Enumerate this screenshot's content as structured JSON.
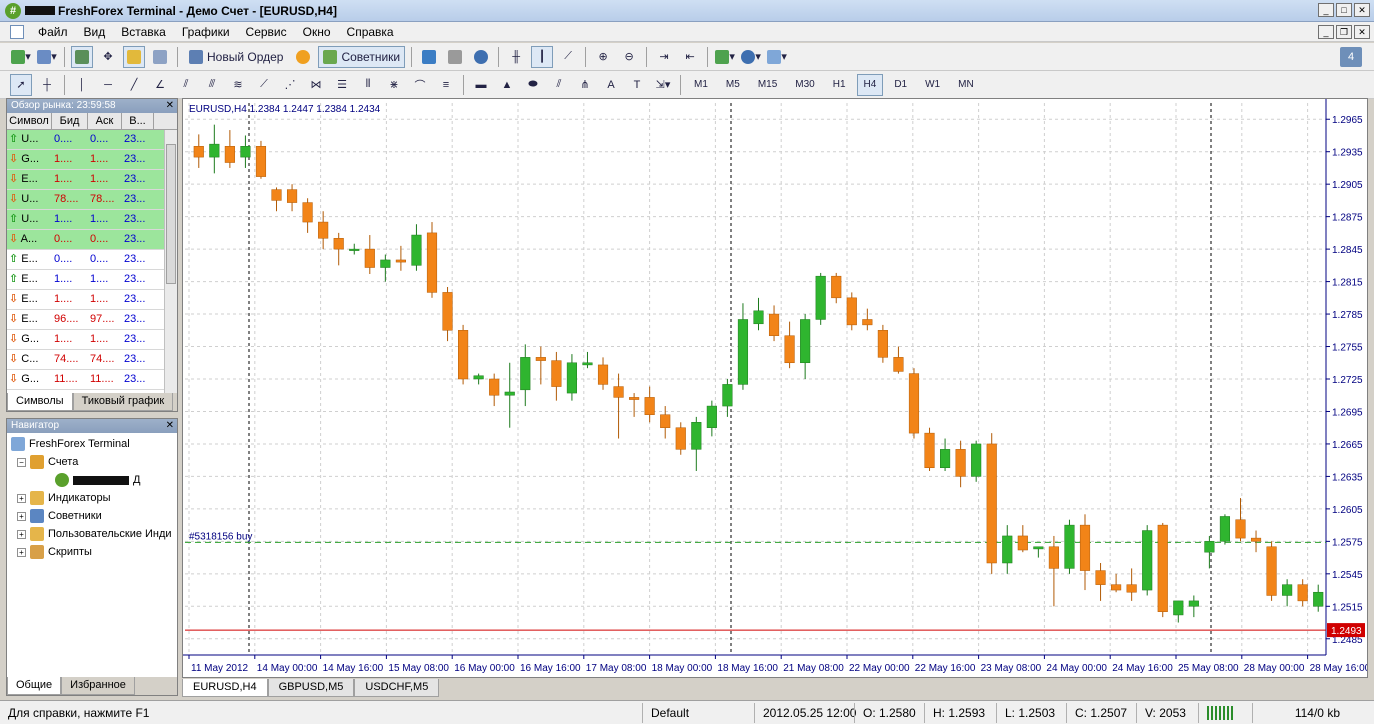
{
  "title": {
    "app": "FreshForex Terminal",
    "account_type": "Демо Счет",
    "chart": "[EURUSD,H4]",
    "separator": " - "
  },
  "menu": [
    "Файл",
    "Вид",
    "Вставка",
    "Графики",
    "Сервис",
    "Окно",
    "Справка"
  ],
  "toolbar": {
    "new_order": "Новый Ордер",
    "advisors": "Советники",
    "timeframes": [
      "M1",
      "M5",
      "M15",
      "M30",
      "H1",
      "H4",
      "D1",
      "W1",
      "MN"
    ],
    "active_timeframe": "H4"
  },
  "market_watch": {
    "title": "Обзор рынка: 23:59:58",
    "headers": [
      "Символ",
      "Бид",
      "Аск",
      "В..."
    ],
    "rows": [
      {
        "dir": "up",
        "sym": "U...",
        "bid": "0....",
        "ask": "0....",
        "t": "23...",
        "hl": true,
        "color": "blue"
      },
      {
        "dir": "down",
        "sym": "G...",
        "bid": "1....",
        "ask": "1....",
        "t": "23...",
        "hl": true,
        "color": "red"
      },
      {
        "dir": "down",
        "sym": "E...",
        "bid": "1....",
        "ask": "1....",
        "t": "23...",
        "hl": true,
        "color": "red"
      },
      {
        "dir": "down",
        "sym": "U...",
        "bid": "78....",
        "ask": "78....",
        "t": "23...",
        "hl": true,
        "color": "red"
      },
      {
        "dir": "up",
        "sym": "U...",
        "bid": "1....",
        "ask": "1....",
        "t": "23...",
        "hl": true,
        "color": "blue"
      },
      {
        "dir": "down",
        "sym": "A...",
        "bid": "0....",
        "ask": "0....",
        "t": "23...",
        "hl": true,
        "color": "red"
      },
      {
        "dir": "up",
        "sym": "E...",
        "bid": "0....",
        "ask": "0....",
        "t": "23...",
        "hl": false,
        "color": "blue"
      },
      {
        "dir": "up",
        "sym": "E...",
        "bid": "1....",
        "ask": "1....",
        "t": "23...",
        "hl": false,
        "color": "blue"
      },
      {
        "dir": "down",
        "sym": "E...",
        "bid": "1....",
        "ask": "1....",
        "t": "23...",
        "hl": false,
        "color": "red"
      },
      {
        "dir": "down",
        "sym": "E...",
        "bid": "96....",
        "ask": "97....",
        "t": "23...",
        "hl": false,
        "color": "red"
      },
      {
        "dir": "down",
        "sym": "G...",
        "bid": "1....",
        "ask": "1....",
        "t": "23...",
        "hl": false,
        "color": "red"
      },
      {
        "dir": "down",
        "sym": "C...",
        "bid": "74....",
        "ask": "74....",
        "t": "23...",
        "hl": false,
        "color": "red"
      },
      {
        "dir": "down",
        "sym": "G...",
        "bid": "11....",
        "ask": "11....",
        "t": "23...",
        "hl": false,
        "color": "red"
      }
    ],
    "tabs": [
      "Символы",
      "Тиковый график"
    ]
  },
  "navigator": {
    "title": "Навигатор",
    "root": "FreshForex Terminal",
    "accounts": "Счета",
    "account_suffix": "Д",
    "indicators": "Индикаторы",
    "experts": "Советники",
    "custom": "Пользовательские Инди",
    "scripts": "Скрипты",
    "tabs": [
      "Общие",
      "Избранное"
    ]
  },
  "chart": {
    "header": "EURUSD,H4  1.2384 1.2447 1.2384 1.2434",
    "order_label": "#5318156 buy",
    "current_price": "1.2493",
    "tabs": [
      "EURUSD,H4",
      "GBPUSD,M5",
      "USDCHF,M5"
    ]
  },
  "chart_data": {
    "type": "candlestick",
    "symbol": "EURUSD",
    "timeframe": "H4",
    "y_ticks": [
      "1.2965",
      "1.2935",
      "1.2905",
      "1.2875",
      "1.2845",
      "1.2815",
      "1.2785",
      "1.2755",
      "1.2725",
      "1.2695",
      "1.2665",
      "1.2635",
      "1.2605",
      "1.2575",
      "1.2545",
      "1.2515",
      "1.2485"
    ],
    "ylim": [
      1.247,
      1.298
    ],
    "x_ticks": [
      "11 May 2012",
      "14 May 00:00",
      "14 May 16:00",
      "15 May 08:00",
      "16 May 00:00",
      "16 May 16:00",
      "17 May 08:00",
      "18 May 00:00",
      "18 May 16:00",
      "21 May 08:00",
      "22 May 00:00",
      "22 May 16:00",
      "23 May 08:00",
      "24 May 00:00",
      "24 May 16:00",
      "25 May 08:00",
      "28 May 00:00",
      "28 May 16:00"
    ],
    "order_level": 1.2574,
    "current_price": 1.2493,
    "candles": [
      [
        1.294,
        1.2951,
        1.292,
        1.293
      ],
      [
        1.293,
        1.296,
        1.2915,
        1.2942
      ],
      [
        1.294,
        1.2955,
        1.292,
        1.2925
      ],
      [
        1.293,
        1.295,
        1.292,
        1.294
      ],
      [
        1.294,
        1.2945,
        1.291,
        1.2912
      ],
      [
        1.29,
        1.2902,
        1.288,
        1.289
      ],
      [
        1.29,
        1.2905,
        1.288,
        1.2888
      ],
      [
        1.2888,
        1.2892,
        1.286,
        1.287
      ],
      [
        1.287,
        1.288,
        1.2845,
        1.2855
      ],
      [
        1.2855,
        1.286,
        1.283,
        1.2845
      ],
      [
        1.2844,
        1.285,
        1.284,
        1.2845
      ],
      [
        1.2845,
        1.2858,
        1.2822,
        1.2828
      ],
      [
        1.2828,
        1.284,
        1.2815,
        1.2835
      ],
      [
        1.2835,
        1.2848,
        1.2825,
        1.2833
      ],
      [
        1.283,
        1.2868,
        1.2825,
        1.2858
      ],
      [
        1.286,
        1.287,
        1.28,
        1.2805
      ],
      [
        1.2805,
        1.281,
        1.276,
        1.277
      ],
      [
        1.277,
        1.2775,
        1.272,
        1.2725
      ],
      [
        1.2725,
        1.273,
        1.272,
        1.2728
      ],
      [
        1.2725,
        1.273,
        1.27,
        1.271
      ],
      [
        1.271,
        1.274,
        1.268,
        1.2713
      ],
      [
        1.2715,
        1.2757,
        1.27,
        1.2745
      ],
      [
        1.2745,
        1.2755,
        1.272,
        1.2742
      ],
      [
        1.2742,
        1.275,
        1.2705,
        1.2718
      ],
      [
        1.2712,
        1.2748,
        1.2705,
        1.274
      ],
      [
        1.2738,
        1.275,
        1.2735,
        1.274
      ],
      [
        1.2738,
        1.2745,
        1.2715,
        1.272
      ],
      [
        1.2718,
        1.273,
        1.267,
        1.2708
      ],
      [
        1.2708,
        1.2712,
        1.269,
        1.2706
      ],
      [
        1.2708,
        1.2718,
        1.2685,
        1.2692
      ],
      [
        1.2692,
        1.27,
        1.267,
        1.268
      ],
      [
        1.268,
        1.2685,
        1.2655,
        1.266
      ],
      [
        1.266,
        1.269,
        1.264,
        1.2685
      ],
      [
        1.268,
        1.2705,
        1.2672,
        1.27
      ],
      [
        1.27,
        1.2725,
        1.269,
        1.272
      ],
      [
        1.272,
        1.2795,
        1.2715,
        1.278
      ],
      [
        1.2776,
        1.28,
        1.277,
        1.2788
      ],
      [
        1.2785,
        1.2793,
        1.276,
        1.2765
      ],
      [
        1.2765,
        1.2778,
        1.2735,
        1.274
      ],
      [
        1.274,
        1.2785,
        1.2725,
        1.278
      ],
      [
        1.278,
        1.2823,
        1.2775,
        1.282
      ],
      [
        1.282,
        1.2823,
        1.2795,
        1.28
      ],
      [
        1.28,
        1.2805,
        1.277,
        1.2775
      ],
      [
        1.278,
        1.279,
        1.277,
        1.2775
      ],
      [
        1.277,
        1.2775,
        1.274,
        1.2745
      ],
      [
        1.2745,
        1.2755,
        1.273,
        1.2732
      ],
      [
        1.273,
        1.2735,
        1.267,
        1.2675
      ],
      [
        1.2675,
        1.268,
        1.264,
        1.2643
      ],
      [
        1.2643,
        1.267,
        1.264,
        1.266
      ],
      [
        1.266,
        1.2668,
        1.2625,
        1.2635
      ],
      [
        1.2635,
        1.2668,
        1.263,
        1.2665
      ],
      [
        1.2665,
        1.2675,
        1.2545,
        1.2555
      ],
      [
        1.2555,
        1.259,
        1.2545,
        1.258
      ],
      [
        1.258,
        1.259,
        1.2565,
        1.2567
      ],
      [
        1.2568,
        1.257,
        1.256,
        1.257
      ],
      [
        1.257,
        1.258,
        1.2515,
        1.255
      ],
      [
        1.255,
        1.2595,
        1.2545,
        1.259
      ],
      [
        1.259,
        1.26,
        1.253,
        1.2548
      ],
      [
        1.2548,
        1.2555,
        1.252,
        1.2535
      ],
      [
        1.2535,
        1.2545,
        1.2528,
        1.253
      ],
      [
        1.2535,
        1.255,
        1.252,
        1.2528
      ],
      [
        1.253,
        1.259,
        1.2525,
        1.2585
      ],
      [
        1.259,
        1.2592,
        1.2505,
        1.251
      ],
      [
        1.2507,
        1.252,
        1.25,
        1.252
      ],
      [
        1.2515,
        1.2525,
        1.2505,
        1.252
      ],
      [
        1.2565,
        1.258,
        1.255,
        1.2575
      ],
      [
        1.2575,
        1.26,
        1.2572,
        1.2598
      ],
      [
        1.2595,
        1.2615,
        1.2575,
        1.2578
      ],
      [
        1.2578,
        1.2585,
        1.2565,
        1.2575
      ],
      [
        1.257,
        1.2575,
        1.252,
        1.2525
      ],
      [
        1.2525,
        1.254,
        1.2515,
        1.2535
      ],
      [
        1.2535,
        1.254,
        1.2515,
        1.252
      ],
      [
        1.2515,
        1.2535,
        1.251,
        1.2528
      ]
    ],
    "up_color": "#2fb52f",
    "down_color": "#f28418",
    "axis_color": "#000080"
  },
  "status": {
    "help": "Для справки, нажмите F1",
    "profile": "Default",
    "datetime": "2012.05.25 12:00",
    "open": "O: 1.2580",
    "high": "H: 1.2593",
    "low": "L: 1.2503",
    "close": "C: 1.2507",
    "volume": "V: 2053",
    "traffic": "114/0 kb"
  }
}
